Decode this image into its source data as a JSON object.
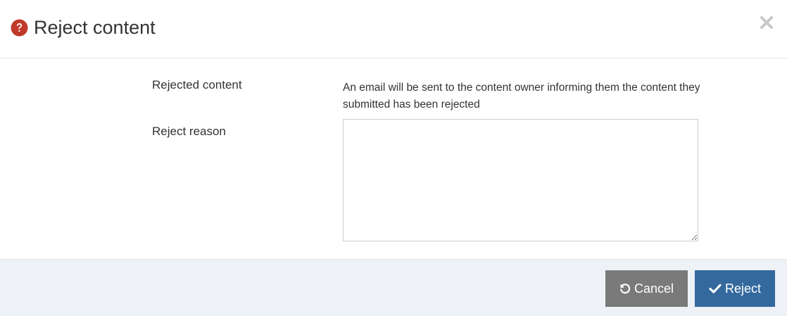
{
  "dialog": {
    "title": "Reject content",
    "header_icon": "question-circle-icon",
    "close_icon": "close-icon"
  },
  "form": {
    "rejected_content_label": "Rejected content",
    "rejected_content_help": "An email will be sent to the content owner informing them the content they submitted has been rejected",
    "reject_reason_label": "Reject reason",
    "reject_reason_value": "",
    "reject_reason_placeholder": ""
  },
  "footer": {
    "cancel_label": "Cancel",
    "cancel_icon": "undo-icon",
    "reject_label": "Reject",
    "reject_icon": "check-icon"
  },
  "colors": {
    "header_icon": "#c0392b",
    "cancel_button": "#7a7a7a",
    "reject_button": "#34699e",
    "footer_background": "#eef1f5"
  }
}
